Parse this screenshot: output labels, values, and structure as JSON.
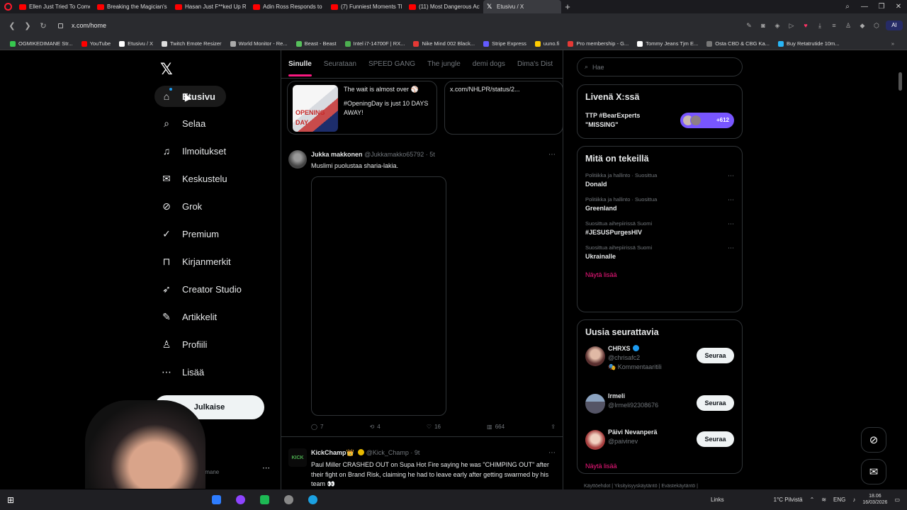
{
  "browser": {
    "tabs": [
      {
        "label": "Ellen Just Tried To Comeb",
        "favicon": "youtube-icon"
      },
      {
        "label": "Breaking the Magician's C",
        "favicon": "youtube-icon"
      },
      {
        "label": "Hasan Just F**ked Up Rea",
        "favicon": "youtube-icon"
      },
      {
        "label": "Adin Ross Responds to Gy",
        "favicon": "youtube-icon"
      },
      {
        "label": "(7) Funniest Moments Th",
        "favicon": "youtube-icon"
      },
      {
        "label": "(11) Most Dangerous Act",
        "favicon": "youtube-icon"
      },
      {
        "label": "Etusivu / X",
        "favicon": "x-icon",
        "active": true
      }
    ],
    "url": "x.com/home",
    "bookmarks": [
      {
        "label": "OGMIKEDIMANE Str...",
        "color": "#37c84f"
      },
      {
        "label": "YouTube",
        "color": "#ff0000"
      },
      {
        "label": "Etusivu / X",
        "color": "#ffffff"
      },
      {
        "label": "Twitch Emote Resizer",
        "color": "#dddddd"
      },
      {
        "label": "World Monitor - Re...",
        "color": "#aaaaaa"
      },
      {
        "label": "Beast - Beast",
        "color": "#57c15c"
      },
      {
        "label": "Intel i7-14700F | RX...",
        "color": "#4caf50"
      },
      {
        "label": "Nike Mind 002 Black...",
        "color": "#e53935"
      },
      {
        "label": "Stripe Express",
        "color": "#635bff"
      },
      {
        "label": "uuno.fi",
        "color": "#ffcc00"
      },
      {
        "label": "Pro membership - G...",
        "color": "#e53935"
      },
      {
        "label": "Tommy Jeans Tjm E...",
        "color": "#ffffff"
      },
      {
        "label": "Osta CBD & CBG Ka...",
        "color": "#777777"
      },
      {
        "label": "Buy Retatrutide 10m...",
        "color": "#29b6f6"
      }
    ]
  },
  "nav": {
    "items": [
      {
        "label": "Etusivu",
        "icon": "home-icon",
        "glyph": "⌂"
      },
      {
        "label": "Selaa",
        "icon": "search-icon",
        "glyph": "⌕"
      },
      {
        "label": "Ilmoitukset",
        "icon": "bell-icon",
        "glyph": "♫"
      },
      {
        "label": "Keskustelu",
        "icon": "mail-icon",
        "glyph": "✉"
      },
      {
        "label": "Grok",
        "icon": "grok-icon",
        "glyph": "⊘"
      },
      {
        "label": "Premium",
        "icon": "premium-icon",
        "glyph": "✓"
      },
      {
        "label": "Kirjanmerkit",
        "icon": "bookmark-icon",
        "glyph": "⊓"
      },
      {
        "label": "Creator Studio",
        "icon": "rocket-icon",
        "glyph": "➶"
      },
      {
        "label": "Artikkelit",
        "icon": "article-icon",
        "glyph": "✎"
      },
      {
        "label": "Profiili",
        "icon": "profile-icon",
        "glyph": "♙"
      },
      {
        "label": "Lisää",
        "icon": "more-icon",
        "glyph": "⋯"
      }
    ],
    "post_label": "Julkaise",
    "profile": {
      "name": "di",
      "handle": "lemane"
    }
  },
  "feed": {
    "tabs": [
      "Sinulle",
      "Seurataan",
      "SPEED GANG",
      "The jungle",
      "demi dogs",
      "Dima's Dist"
    ],
    "cards": [
      {
        "text1": "The wait is almost over ⚾",
        "text2": "#OpeningDay is just 10 DAYS AWAY!",
        "img_label": "OPENING DAY"
      },
      {
        "text1": "x.com/NHLPR/status/2..."
      }
    ],
    "tweets": [
      {
        "name": "Jukka makkonen",
        "handle": "@Jukkamakko65792 · 5t",
        "text": "Muslimi puolustaa sharia-lakia.",
        "replies": "7",
        "reposts": "4",
        "likes": "16",
        "views": "664"
      },
      {
        "name": "KickChamp👑",
        "handle": "@Kick_Champ · 9t",
        "avatar_label": "KICK",
        "text": "Paul Miller CRASHED OUT on Supa Hot Fire saying he was \"CHIMPING OUT\" after their fight on Brand Risk, claiming he had to leave early after getting swarmed by his team 👀"
      }
    ]
  },
  "sidebar": {
    "search_placeholder": "Hae",
    "live": {
      "title": "Livenä X:ssä",
      "text": "TTP #BearExperts \"MISSING\"",
      "count": "+612"
    },
    "trends": {
      "title": "Mitä on tekeillä",
      "items": [
        {
          "context": "Politiikka ja hallinto · Suosittua",
          "name": "Donald"
        },
        {
          "context": "Politiikka ja hallinto · Suosittua",
          "name": "Greenland"
        },
        {
          "context": "Suosittua aihepiirissä Suomi",
          "name": "#JESUSPurgesHIV"
        },
        {
          "context": "Suosittua aihepiirissä Suomi",
          "name": "Ukrainalle"
        }
      ],
      "show_more": "Näytä lisää"
    },
    "follow": {
      "title": "Uusia seurattavia",
      "items": [
        {
          "name": "CHRXS",
          "handle": "@chrisafc2",
          "extra": "🎭 Kommentaaritili",
          "button": "Seuraa"
        },
        {
          "name": "Irmeli",
          "handle": "@Irmeli92308676",
          "button": "Seuraa"
        },
        {
          "name": "Päivi Nevanperä",
          "handle": "@paivinev",
          "button": "Seuraa"
        }
      ],
      "show_more": "Näytä lisää"
    },
    "footer": "Käyttöehdot  |  Yksityisyyskäytäntö  |  Evästekäytäntö  |"
  },
  "taskbar": {
    "links": "Links",
    "weather": "1°C  Pilvistä",
    "lang": "ENG",
    "time": "18.06",
    "date": "16/03/2026"
  },
  "colors": {
    "accent": "#f91880",
    "blue": "#1d9bf0",
    "bg": "#000000"
  }
}
